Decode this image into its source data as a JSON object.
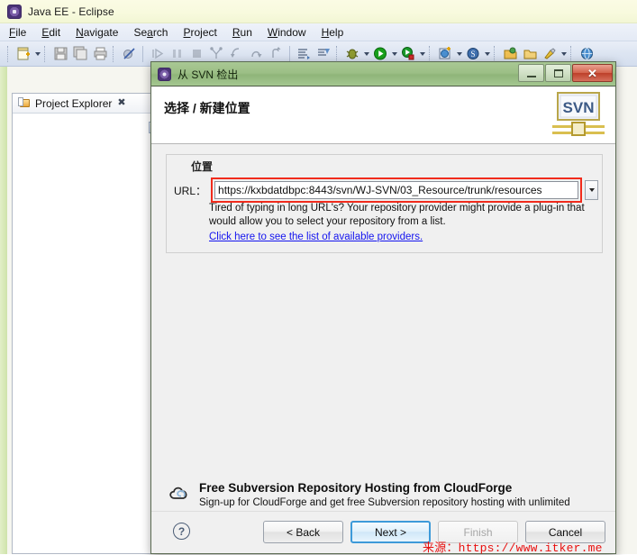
{
  "app": {
    "title": "Java EE - Eclipse",
    "icon": "eclipse-icon"
  },
  "menubar": {
    "items": [
      {
        "label": "File",
        "mnemonic": "F"
      },
      {
        "label": "Edit",
        "mnemonic": "E"
      },
      {
        "label": "Navigate",
        "mnemonic": "N"
      },
      {
        "label": "Search",
        "mnemonic": "a"
      },
      {
        "label": "Project",
        "mnemonic": "P"
      },
      {
        "label": "Run",
        "mnemonic": "R"
      },
      {
        "label": "Window",
        "mnemonic": "W"
      },
      {
        "label": "Help",
        "mnemonic": "H"
      }
    ]
  },
  "toolbar": {
    "icons": [
      "new-wizard-icon",
      "save-icon",
      "save-all-icon",
      "print-icon",
      "toggle-breakpoint-icon",
      "resume-icon",
      "suspend-icon",
      "terminate-icon",
      "step-into-selection-icon",
      "step-into-icon",
      "step-over-icon",
      "step-return-icon",
      "open-task-icon",
      "new-task-icon",
      "debug-icon",
      "run-icon",
      "external-tools-icon",
      "new-web-project-icon",
      "new-server-icon",
      "open-type-icon",
      "open-resource-icon",
      "search-icon",
      "browser-icon"
    ]
  },
  "project_explorer": {
    "tab_label": "Project Explorer",
    "close_glyph": "✖",
    "minimize_tooltip": "Minimize"
  },
  "dialog": {
    "title": "从 SVN 检出",
    "heading": "选择 / 新建位置",
    "logo_text": "SVN",
    "window_buttons": {
      "minimize": "minimize-icon",
      "maximize": "maximize-icon",
      "close": "close-icon"
    },
    "group": {
      "legend": "位置",
      "url_label": "URL：",
      "url_value": "https://kxbdatdbpc:8443/svn/WJ-SVN/03_Resource/trunk/resources",
      "url_placeholder": "",
      "hint": "Tired of typing in long URL's?  Your repository provider might provide a plug-in that would allow you to select your repository from a list.",
      "link": "Click here to see the list of available providers.",
      "highlight_color": "#f12b1c"
    },
    "cloudforge": {
      "title": "Free Subversion Repository Hosting from CloudForge",
      "description": "Sign-up for CloudForge and get free Subversion repository hosting with unlimited users and repositories, plus free agile tracker tools.",
      "icon": "cloud-icon"
    },
    "footer": {
      "help": "?",
      "buttons": [
        {
          "label": "< Back",
          "state": "enabled",
          "name": "back-button"
        },
        {
          "label": "Next >",
          "state": "default",
          "name": "next-button"
        },
        {
          "label": "Finish",
          "state": "disabled",
          "name": "finish-button"
        },
        {
          "label": "Cancel",
          "state": "enabled",
          "name": "cancel-button"
        }
      ]
    }
  },
  "watermark": {
    "prefix": "来源：",
    "url": "https://www.itker.me"
  }
}
